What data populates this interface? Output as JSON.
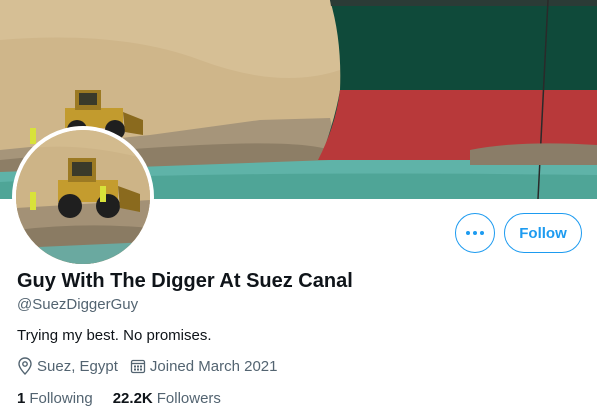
{
  "profile": {
    "display_name": "Guy With The Digger At Suez Canal",
    "handle": "@SuezDiggerGuy",
    "bio": "Trying my best. No promises.",
    "location": "Suez, Egypt",
    "joined": "Joined March 2021",
    "following_count": "1",
    "following_label": "Following",
    "followers_count": "22.2K",
    "followers_label": "Followers"
  },
  "actions": {
    "follow_label": "Follow",
    "more_icon": "more-horizontal-icon"
  },
  "icons": {
    "location": "location-pin-icon",
    "calendar": "calendar-icon"
  },
  "colors": {
    "accent": "#1d9bf0",
    "secondary_text": "#536471",
    "primary_text": "#0f1419"
  }
}
